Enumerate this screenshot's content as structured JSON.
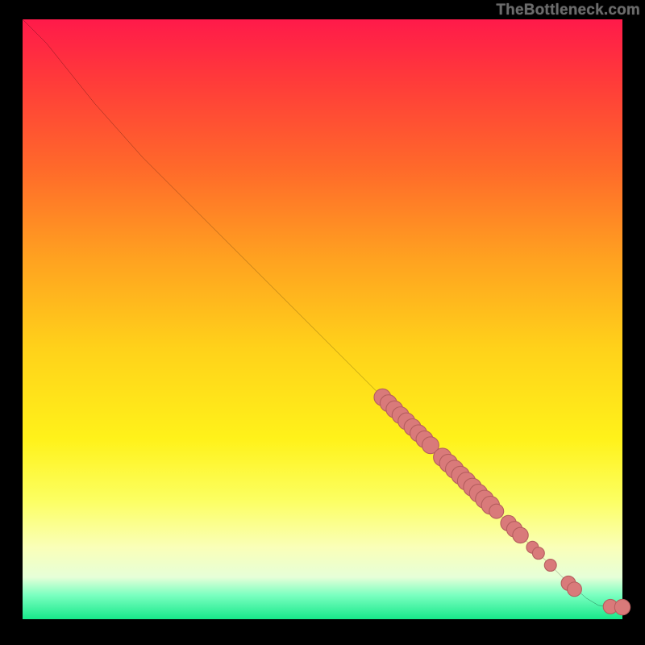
{
  "watermark": "TheBottleneck.com",
  "chart_data": {
    "type": "line",
    "title": "",
    "xlabel": "",
    "ylabel": "",
    "xlim": [
      0,
      100
    ],
    "ylim": [
      0,
      100
    ],
    "curve": [
      {
        "x": 0,
        "y": 100
      },
      {
        "x": 4,
        "y": 96
      },
      {
        "x": 8,
        "y": 91
      },
      {
        "x": 12,
        "y": 86
      },
      {
        "x": 20,
        "y": 77
      },
      {
        "x": 30,
        "y": 67
      },
      {
        "x": 40,
        "y": 57
      },
      {
        "x": 50,
        "y": 47
      },
      {
        "x": 60,
        "y": 37
      },
      {
        "x": 70,
        "y": 27
      },
      {
        "x": 80,
        "y": 17
      },
      {
        "x": 90,
        "y": 7
      },
      {
        "x": 94,
        "y": 3.5
      },
      {
        "x": 96,
        "y": 2.3
      },
      {
        "x": 98,
        "y": 2.1
      },
      {
        "x": 100,
        "y": 2.0
      }
    ],
    "points": [
      {
        "x": 60,
        "y": 37,
        "r": 1.4
      },
      {
        "x": 61,
        "y": 36,
        "r": 1.4
      },
      {
        "x": 62,
        "y": 35,
        "r": 1.4
      },
      {
        "x": 63,
        "y": 34,
        "r": 1.4
      },
      {
        "x": 64,
        "y": 33,
        "r": 1.4
      },
      {
        "x": 65,
        "y": 32,
        "r": 1.4
      },
      {
        "x": 66,
        "y": 31,
        "r": 1.4
      },
      {
        "x": 67,
        "y": 30,
        "r": 1.4
      },
      {
        "x": 68,
        "y": 29,
        "r": 1.4
      },
      {
        "x": 70,
        "y": 27,
        "r": 1.5
      },
      {
        "x": 71,
        "y": 26,
        "r": 1.5
      },
      {
        "x": 72,
        "y": 25,
        "r": 1.5
      },
      {
        "x": 73,
        "y": 24,
        "r": 1.5
      },
      {
        "x": 74,
        "y": 23,
        "r": 1.5
      },
      {
        "x": 75,
        "y": 22,
        "r": 1.5
      },
      {
        "x": 76,
        "y": 21,
        "r": 1.5
      },
      {
        "x": 77,
        "y": 20,
        "r": 1.5
      },
      {
        "x": 78,
        "y": 19,
        "r": 1.5
      },
      {
        "x": 79,
        "y": 18,
        "r": 1.2
      },
      {
        "x": 81,
        "y": 16,
        "r": 1.3
      },
      {
        "x": 82,
        "y": 15,
        "r": 1.3
      },
      {
        "x": 83,
        "y": 14,
        "r": 1.3
      },
      {
        "x": 85,
        "y": 12,
        "r": 1.0
      },
      {
        "x": 86,
        "y": 11,
        "r": 1.0
      },
      {
        "x": 88,
        "y": 9,
        "r": 1.0
      },
      {
        "x": 91,
        "y": 6,
        "r": 1.2
      },
      {
        "x": 92,
        "y": 5,
        "r": 1.2
      },
      {
        "x": 98,
        "y": 2.1,
        "r": 1.2
      },
      {
        "x": 100,
        "y": 2.0,
        "r": 1.3
      }
    ],
    "colors": {
      "curve": "#000000",
      "point_fill": "#d97a7a",
      "point_stroke": "#b55e5e"
    }
  }
}
